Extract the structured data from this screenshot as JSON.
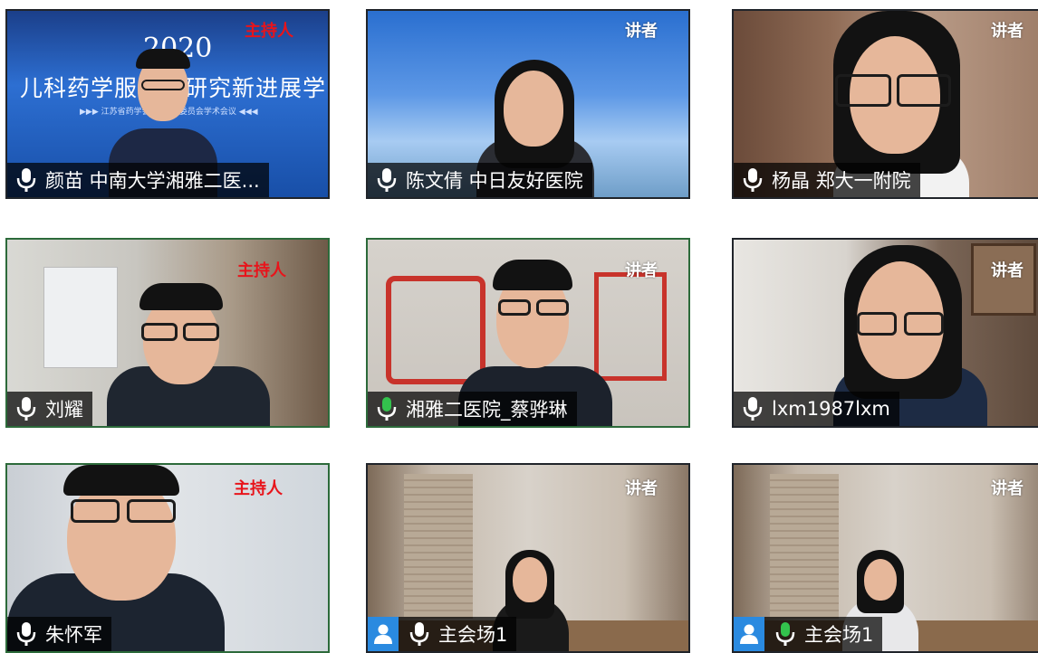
{
  "tiles": [
    {
      "name": "颜苗 中南大学湘雅二医...",
      "role": "主持人",
      "mic": "white",
      "banner": {
        "year": "2020",
        "title": "儿科药学服务与研究新进展学习班",
        "subtitle": "▶▶▶ 江苏省药学会 ... 专业委员会学术会议 ◀◀◀"
      }
    },
    {
      "name": "陈文倩 中日友好医院",
      "role": "讲者",
      "mic": "white"
    },
    {
      "name": "杨晶 郑大一附院",
      "role": "讲者",
      "mic": "white"
    },
    {
      "name": "刘耀",
      "role": "主持人",
      "mic": "white"
    },
    {
      "name": "湘雅二医院_蔡骅琳",
      "role": "讲者",
      "mic": "green"
    },
    {
      "name": "lxm1987lxm",
      "role": "讲者",
      "mic": "white"
    },
    {
      "name": "朱怀军",
      "role": "主持人",
      "mic": "white"
    },
    {
      "name": "主会场1",
      "role": "讲者",
      "mic": "white",
      "avatar": true
    },
    {
      "name": "主会场1",
      "role": "讲者",
      "mic": "green",
      "avatar": true
    }
  ],
  "colors": {
    "host_role": "#e8141b",
    "speaker_role": "#ffffff",
    "mic_green": "#33c24d",
    "mic_white": "#ffffff",
    "avatar_bg": "#2a8ae0"
  },
  "icons": {
    "mic": "microphone-icon",
    "avatar": "user-avatar-icon"
  }
}
